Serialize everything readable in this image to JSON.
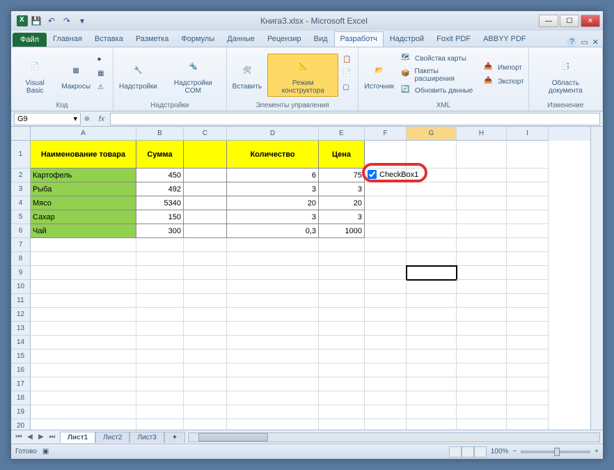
{
  "title": "Книга3.xlsx - Microsoft Excel",
  "qat": {
    "save": "💾",
    "undo": "↶",
    "redo": "↷"
  },
  "tabs": {
    "file": "Файл",
    "list": [
      "Главная",
      "Вставка",
      "Разметка",
      "Формулы",
      "Данные",
      "Рецензир",
      "Вид",
      "Разработч",
      "Надстрой",
      "Foxit PDF",
      "ABBYY PDF"
    ],
    "active_index": 8
  },
  "ribbon": {
    "code": {
      "vb": "Visual\nBasic",
      "macros": "Макросы",
      "label": "Код"
    },
    "addins": {
      "addins": "Надстройки",
      "com": "Надстройки\nCOM",
      "label": "Надстройки"
    },
    "controls": {
      "insert": "Вставить",
      "design": "Режим\nконструктора",
      "label": "Элементы управления"
    },
    "xml": {
      "source": "Источник",
      "props": "Свойства карты",
      "packs": "Пакеты расширения",
      "refresh": "Обновить данные",
      "import": "Импорт",
      "export": "Экспорт",
      "label": "XML"
    },
    "doc": {
      "panel": "Область\nдокумента",
      "label": "Изменение"
    }
  },
  "namebox": "G9",
  "fx": "fx",
  "columns": [
    "A",
    "B",
    "C",
    "D",
    "E",
    "F",
    "G",
    "H",
    "I"
  ],
  "selected_col": "G",
  "headers": {
    "A": "Наименование товара",
    "B": "Сумма",
    "D": "Количество",
    "E": "Цена"
  },
  "data_rows": [
    {
      "A": "Картофель",
      "B": "450",
      "D": "6",
      "E": "75"
    },
    {
      "A": "Рыба",
      "B": "492",
      "D": "3",
      "E": "3"
    },
    {
      "A": "Мясо",
      "B": "5340",
      "D": "20",
      "E": "20"
    },
    {
      "A": "Сахар",
      "B": "150",
      "D": "3",
      "E": "3"
    },
    {
      "A": "Чай",
      "B": "300",
      "D": "0,3",
      "E": "1000"
    }
  ],
  "checkbox_label": "CheckBox1",
  "sheets": [
    "Лист1",
    "Лист2",
    "Лист3"
  ],
  "status": "Готово",
  "zoom": "100%"
}
